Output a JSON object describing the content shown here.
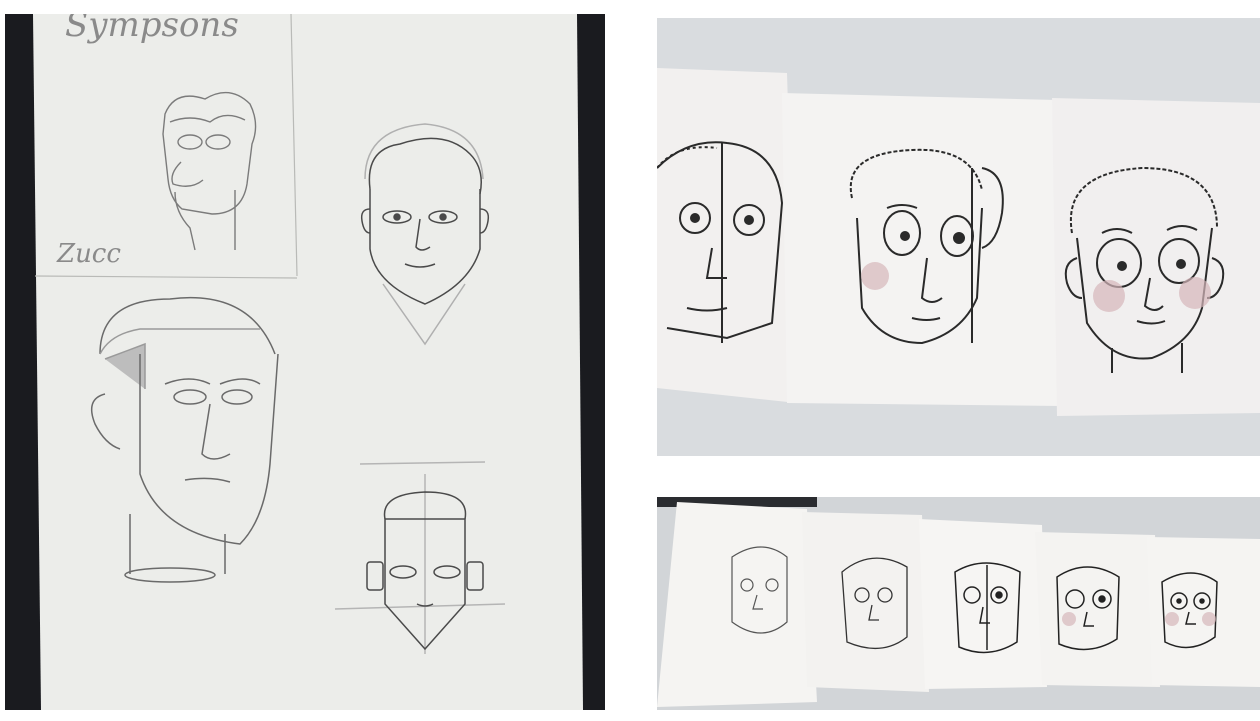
{
  "photos": {
    "left": {
      "caption_top": "Sympsons",
      "caption_side": "Zucc",
      "paper_color": "#ecedea",
      "backdrop_color": "#1a1b1f"
    },
    "top_right": {
      "paper_color": "#f3f1f0",
      "backdrop_color": "#d9dcdf"
    },
    "bottom_right": {
      "paper_color": "#f5f4f2",
      "backdrop_color": "#d2d5d8"
    }
  },
  "colors": {
    "pencil": "#6f6f6f",
    "pen": "#2a2a2a",
    "blush": "#c9a8ad"
  }
}
